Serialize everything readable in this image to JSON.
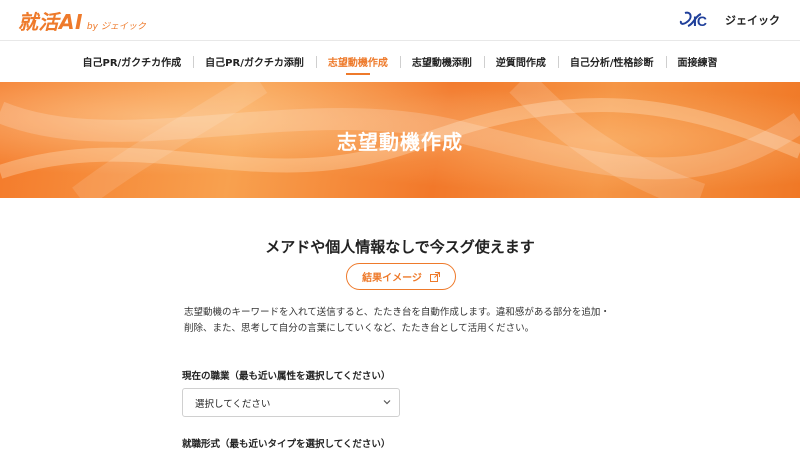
{
  "header": {
    "logo_main": "就活AI",
    "logo_sub": "by ジェイック",
    "brand_mark": "JAIC",
    "brand_name": "ジェイック"
  },
  "nav": {
    "items": [
      {
        "label": "自己PR/ガクチカ作成",
        "active": false
      },
      {
        "label": "自己PR/ガクチカ添削",
        "active": false
      },
      {
        "label": "志望動機作成",
        "active": true
      },
      {
        "label": "志望動機添削",
        "active": false
      },
      {
        "label": "逆質問作成",
        "active": false
      },
      {
        "label": "自己分析/性格診断",
        "active": false
      },
      {
        "label": "面接練習",
        "active": false
      }
    ]
  },
  "hero": {
    "title": "志望動機作成"
  },
  "main": {
    "headline": "メアドや個人情報なしで今スグ使えます",
    "result_button": "結果イメージ",
    "result_button_icon": "external-link-icon",
    "description": "志望動機のキーワードを入れて送信すると、たたき台を自動作成します。違和感がある部分を追加・削除、また、思考して自分の言葉にしていくなど、たたき台として活用ください。"
  },
  "form": {
    "occupation_label": "現在の職業（最も近い属性を選択してください）",
    "occupation_value": "選択してください",
    "employment_label": "就職形式（最も近いタイプを選択してください）"
  },
  "colors": {
    "accent": "#ee7a2b",
    "brand_blue": "#1f3f9a"
  }
}
